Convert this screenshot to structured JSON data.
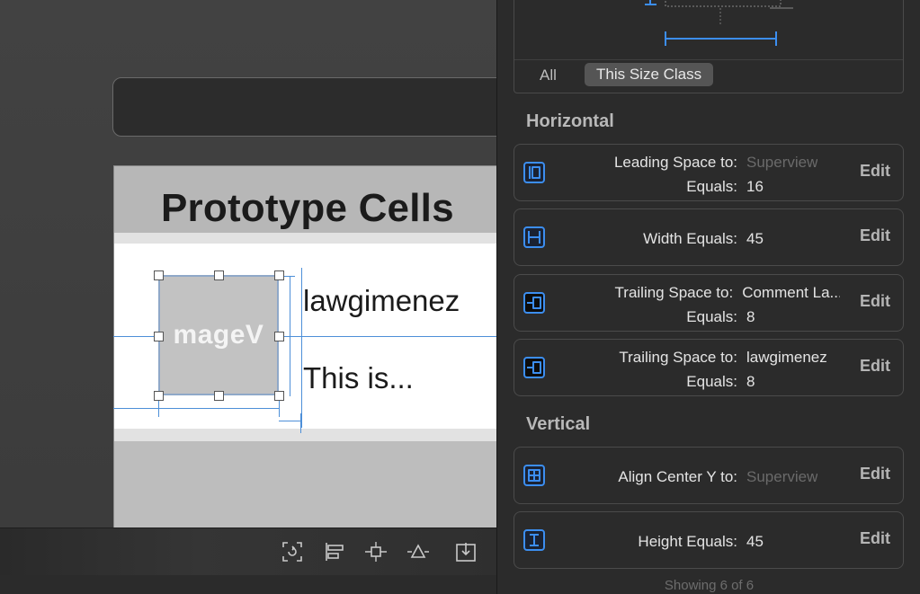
{
  "canvas": {
    "section_title": "Prototype Cells",
    "image_view_label": "mageV",
    "name_label": "lawgimenez",
    "comment_label": "This is..."
  },
  "toolbar": {
    "buttons": [
      {
        "icon": "update-frames-icon"
      },
      {
        "icon": "align-icon"
      },
      {
        "icon": "add-constraints-icon"
      },
      {
        "icon": "resolve-issues-icon"
      },
      {
        "icon": "embed-in-icon"
      }
    ]
  },
  "inspector": {
    "size_class_all": "All",
    "size_class_this": "This Size Class",
    "horizontal_heading": "Horizontal",
    "vertical_heading": "Vertical",
    "constraints": {
      "leading": {
        "key1": "Leading Space to:",
        "val1": "Superview",
        "key2": "Equals:",
        "val2": "16",
        "edit": "Edit"
      },
      "width": {
        "key1": "Width Equals:",
        "val1": "45",
        "edit": "Edit"
      },
      "trailing_comment": {
        "key1": "Trailing Space to:",
        "val1": "Comment La...",
        "key2": "Equals:",
        "val2": "8",
        "edit": "Edit"
      },
      "trailing_name": {
        "key1": "Trailing Space to:",
        "val1": "lawgimenez",
        "key2": "Equals:",
        "val2": "8",
        "edit": "Edit"
      },
      "center_y": {
        "key1": "Align Center Y to:",
        "val1": "Superview",
        "edit": "Edit"
      },
      "height": {
        "key1": "Height Equals:",
        "val1": "45",
        "edit": "Edit"
      }
    },
    "showing": "Showing 6 of 6"
  },
  "colors": {
    "accent": "#3c8ef0",
    "guide": "#4d8fd8"
  }
}
